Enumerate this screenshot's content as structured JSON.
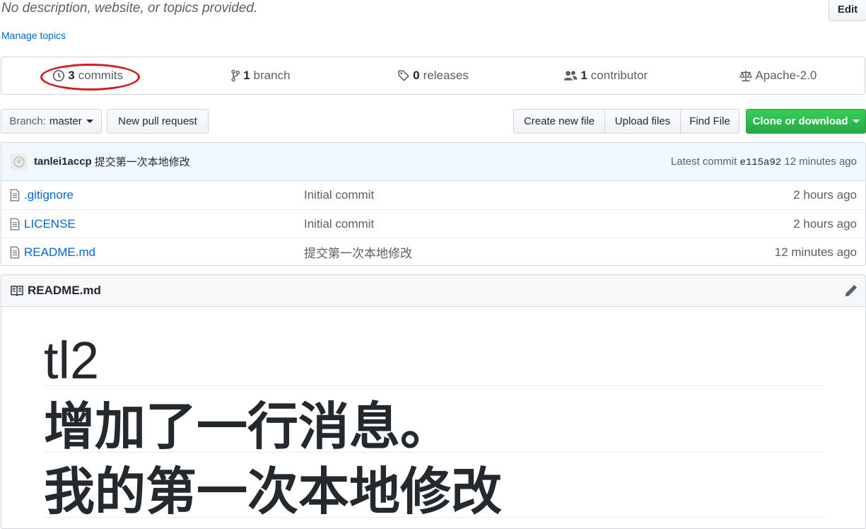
{
  "repo": {
    "description": "No description, website, or topics provided.",
    "edit_label": "Edit",
    "manage_topics": "Manage topics"
  },
  "summary": {
    "commits_count": "3",
    "commits_label": "commits",
    "branches_count": "1",
    "branches_label": "branch",
    "releases_count": "0",
    "releases_label": "releases",
    "contributors_count": "1",
    "contributors_label": "contributor",
    "license": "Apache-2.0"
  },
  "annotation_color": "#d41a1a",
  "toolbar": {
    "branch_prefix": "Branch:",
    "branch_name": "master",
    "new_pull_request": "New pull request",
    "create_new_file": "Create new file",
    "upload_files": "Upload files",
    "find_file": "Find File",
    "clone_or_download": "Clone or download"
  },
  "latest_commit": {
    "author": "tanlei1accp",
    "message": "提交第一次本地修改",
    "latest_label": "Latest commit",
    "sha": "e115a92",
    "age": "12 minutes ago"
  },
  "files": [
    {
      "name": ".gitignore",
      "message": "Initial commit",
      "age": "2 hours ago"
    },
    {
      "name": "LICENSE",
      "message": "Initial commit",
      "age": "2 hours ago"
    },
    {
      "name": "README.md",
      "message": "提交第一次本地修改",
      "age": "12 minutes ago"
    }
  ],
  "readme": {
    "filename": "README.md",
    "headings": [
      "tl2",
      "增加了一行消息。",
      "我的第一次本地修改"
    ]
  },
  "colors": {
    "link": "#0366d6",
    "clone_button": "#28a745",
    "commit_bar": "#f1f8ff"
  }
}
